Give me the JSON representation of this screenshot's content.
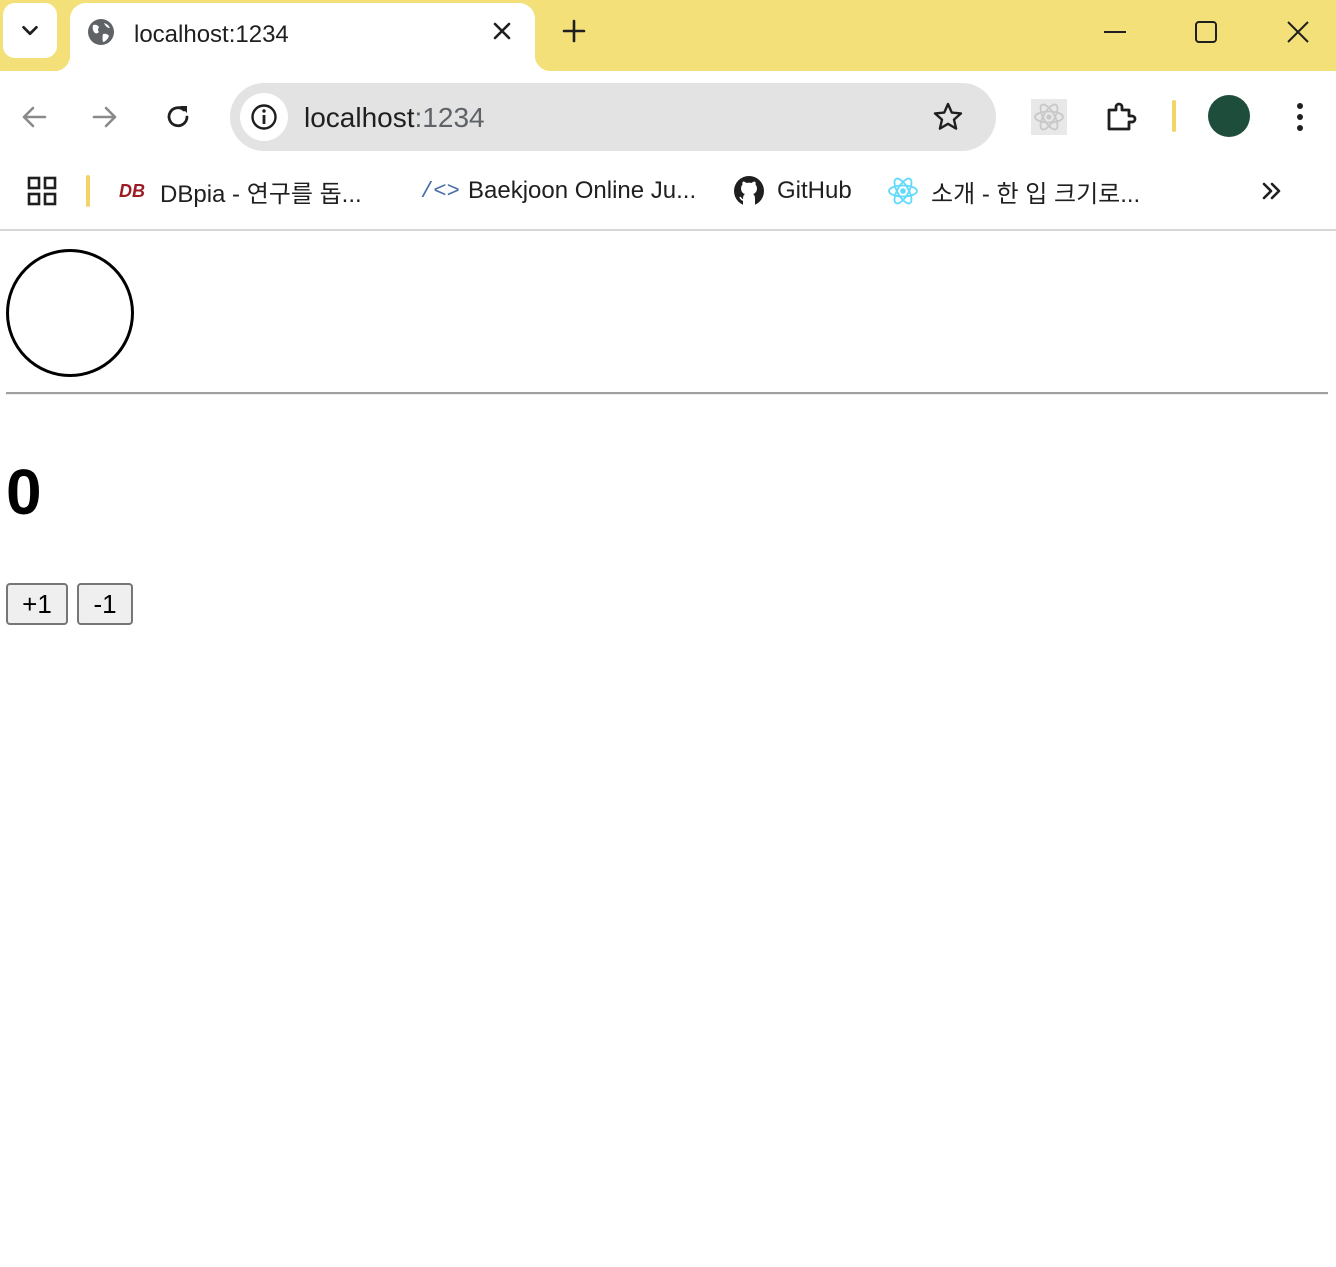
{
  "tab": {
    "title": "localhost:1234"
  },
  "omnibox": {
    "host": "localhost",
    "port": ":1234"
  },
  "bookmarks": [
    {
      "logo": "DB",
      "label": "DBpia - 연구를 돕..."
    },
    {
      "logo": "/<>",
      "label": "Baekjoon Online Ju..."
    },
    {
      "logo": "github-icon",
      "label": "GitHub"
    },
    {
      "logo": "react-icon",
      "label": "소개 - 한 입 크기로..."
    }
  ],
  "page": {
    "count": "0",
    "increment_label": "+1",
    "decrement_label": "-1"
  },
  "colors": {
    "tabstrip": "#f3e078",
    "omnibox": "#e3e3e3",
    "profile": "#1e4d3c",
    "dbpia": "#9b1c23",
    "react": "#61dafb"
  },
  "icons": [
    "chevron-down-icon",
    "globe-icon",
    "close-icon",
    "plus-icon",
    "minimize-icon",
    "maximize-icon",
    "window-close-icon",
    "back-arrow-icon",
    "forward-arrow-icon",
    "reload-icon",
    "info-icon",
    "star-icon",
    "react-devtools-icon",
    "extensions-icon",
    "apps-grid-icon",
    "chevron-double-right-icon"
  ]
}
